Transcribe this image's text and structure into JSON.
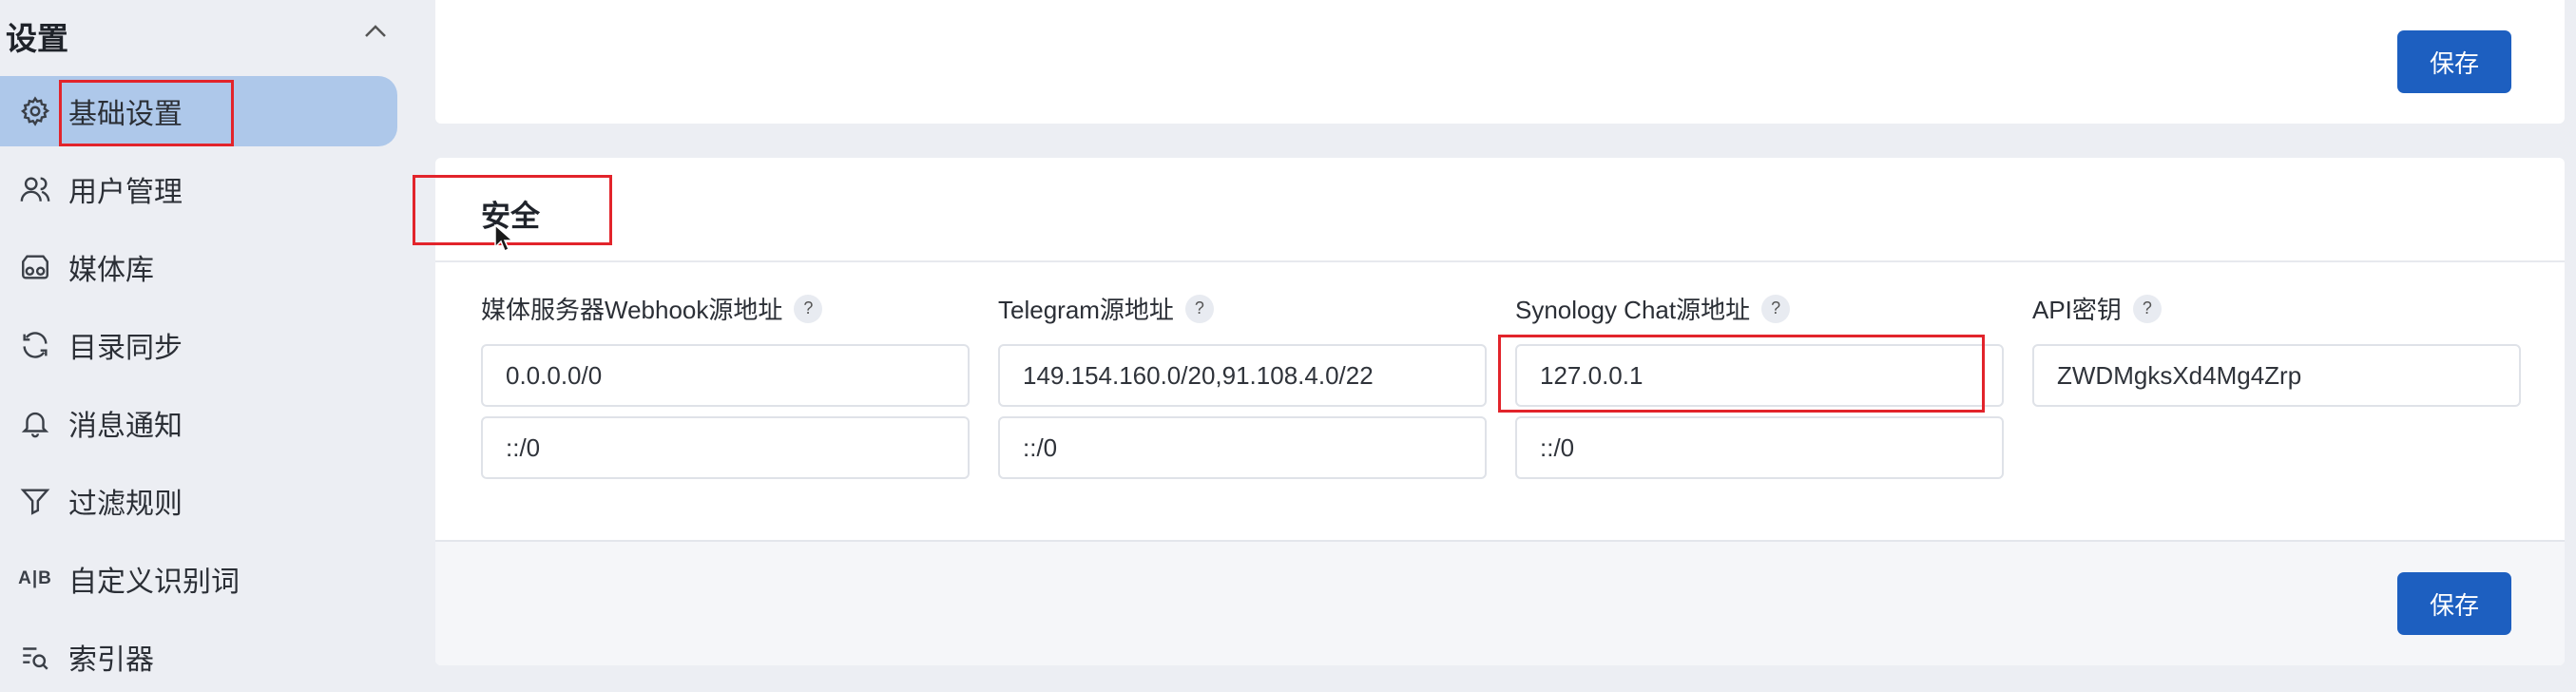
{
  "sidebar": {
    "title": "设置",
    "items": [
      {
        "label": "基础设置",
        "icon": "gear-icon"
      },
      {
        "label": "用户管理",
        "icon": "users-icon"
      },
      {
        "label": "媒体库",
        "icon": "media-library-icon"
      },
      {
        "label": "目录同步",
        "icon": "sync-icon"
      },
      {
        "label": "消息通知",
        "icon": "bell-icon"
      },
      {
        "label": "过滤规则",
        "icon": "filter-icon"
      },
      {
        "label": "自定义识别词",
        "icon": "ab-text-icon",
        "icon_text": "A|B"
      },
      {
        "label": "索引器",
        "icon": "indexer-search-icon"
      }
    ],
    "active_index": 0
  },
  "top_card": {
    "save_label": "保存"
  },
  "security": {
    "title": "安全",
    "fields": [
      {
        "label": "媒体服务器Webhook源地址",
        "help": "?",
        "values": [
          "0.0.0.0/0",
          "::/0"
        ]
      },
      {
        "label": "Telegram源地址",
        "help": "?",
        "values": [
          "149.154.160.0/20,91.108.4.0/22",
          "::/0"
        ]
      },
      {
        "label": "Synology Chat源地址",
        "help": "?",
        "values": [
          "127.0.0.1",
          "::/0"
        ]
      },
      {
        "label": "API密钥",
        "help": "?",
        "values": [
          "ZWDMgksXd4Mg4Zrp"
        ]
      }
    ],
    "save_label": "保存"
  },
  "colors": {
    "accent": "#1d5fc0",
    "active_nav": "#aec8ea",
    "highlight_box": "#e2242b",
    "background": "#eceef3"
  }
}
